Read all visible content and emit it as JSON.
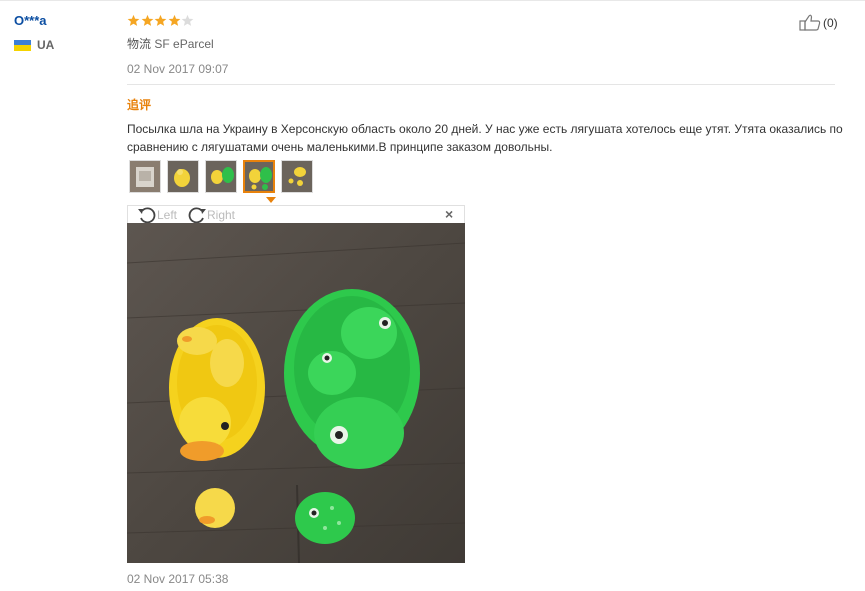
{
  "reviewer": {
    "name": "O***a",
    "country_code": "UA"
  },
  "rating": {
    "stars": 4,
    "max": 5
  },
  "logistics": {
    "label": "物流",
    "value": "SF eParcel"
  },
  "review_date": "02 Nov 2017 09:07",
  "helpful": {
    "count": "(0)"
  },
  "followup": {
    "heading": "追评",
    "text": "Посылка шла на Украину в Херсонскую область около 20 дней. У нас уже есть лягушата хотелось еще утят. Утята оказались по сравнению с лягушатами очень маленькими.В принципе заказом довольны.",
    "date": "02 Nov 2017 05:38"
  },
  "viewer": {
    "rotate_left": "Left",
    "rotate_right": "Right",
    "close": "×"
  },
  "thumbnails": {
    "count": 5,
    "active_index": 3
  },
  "colors": {
    "accent": "#e8820c",
    "name_blue": "#0b4ea2",
    "star": "#f5a623"
  },
  "icons": [
    "thumbs-up-icon",
    "star-icon",
    "rotate-left-icon",
    "rotate-right-icon",
    "close-icon",
    "ukraine-flag-icon"
  ]
}
